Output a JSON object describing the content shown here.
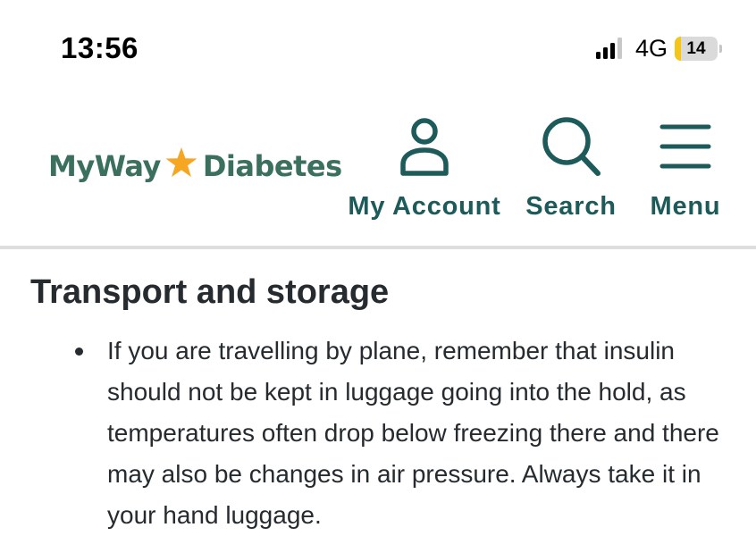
{
  "status_bar": {
    "time": "13:56",
    "network": "4G",
    "battery_level": "14",
    "battery_fraction": 0.14,
    "signal_bars_active": 3,
    "signal_bars_total": 4
  },
  "header": {
    "logo": {
      "left_text": "MyWay",
      "right_text": "Diabetes",
      "star_color": "#f5a623",
      "text_color": "#3b6f5e"
    },
    "nav": {
      "account_label": "My Account",
      "search_label": "Search",
      "menu_label": "Menu",
      "icon_color": "#1d5a5a"
    }
  },
  "content": {
    "heading": "Transport and storage",
    "bullets": [
      "If you are travelling by plane, remember that insulin should not be kept in luggage going into the hold, as temperatures often drop below freezing there and there may also be changes in air pressure. Always take it in your hand luggage."
    ]
  }
}
